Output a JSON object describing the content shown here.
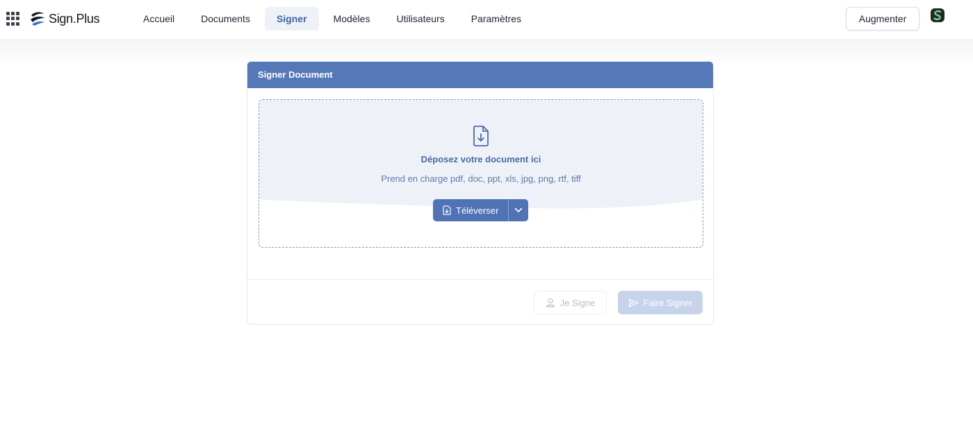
{
  "brand": {
    "name": "Sign.Plus"
  },
  "nav": {
    "items": [
      {
        "label": "Accueil",
        "active": false
      },
      {
        "label": "Documents",
        "active": false
      },
      {
        "label": "Signer",
        "active": true
      },
      {
        "label": "Modèles",
        "active": false
      },
      {
        "label": "Utilisateurs",
        "active": false
      },
      {
        "label": "Paramètres",
        "active": false
      }
    ],
    "upgrade_label": "Augmenter",
    "avatar_icon": "sign-plus-user-avatar-icon"
  },
  "card": {
    "title": "Signer Document",
    "dropzone": {
      "icon": "file-download-icon",
      "title": "Déposez votre document ici",
      "subtitle": "Prend en charge pdf, doc, ppt, xls, jpg, png, rtf, tiff",
      "upload_label": "Téléverser"
    },
    "footer": {
      "self_sign_label": "Je Signe",
      "request_sign_label": "Faire Signer"
    }
  },
  "colors": {
    "accent": "#5578b9",
    "accent_dark": "#4f73b4",
    "active_nav_text": "#3f66aa",
    "disabled_primary": "#c7d3ea"
  }
}
